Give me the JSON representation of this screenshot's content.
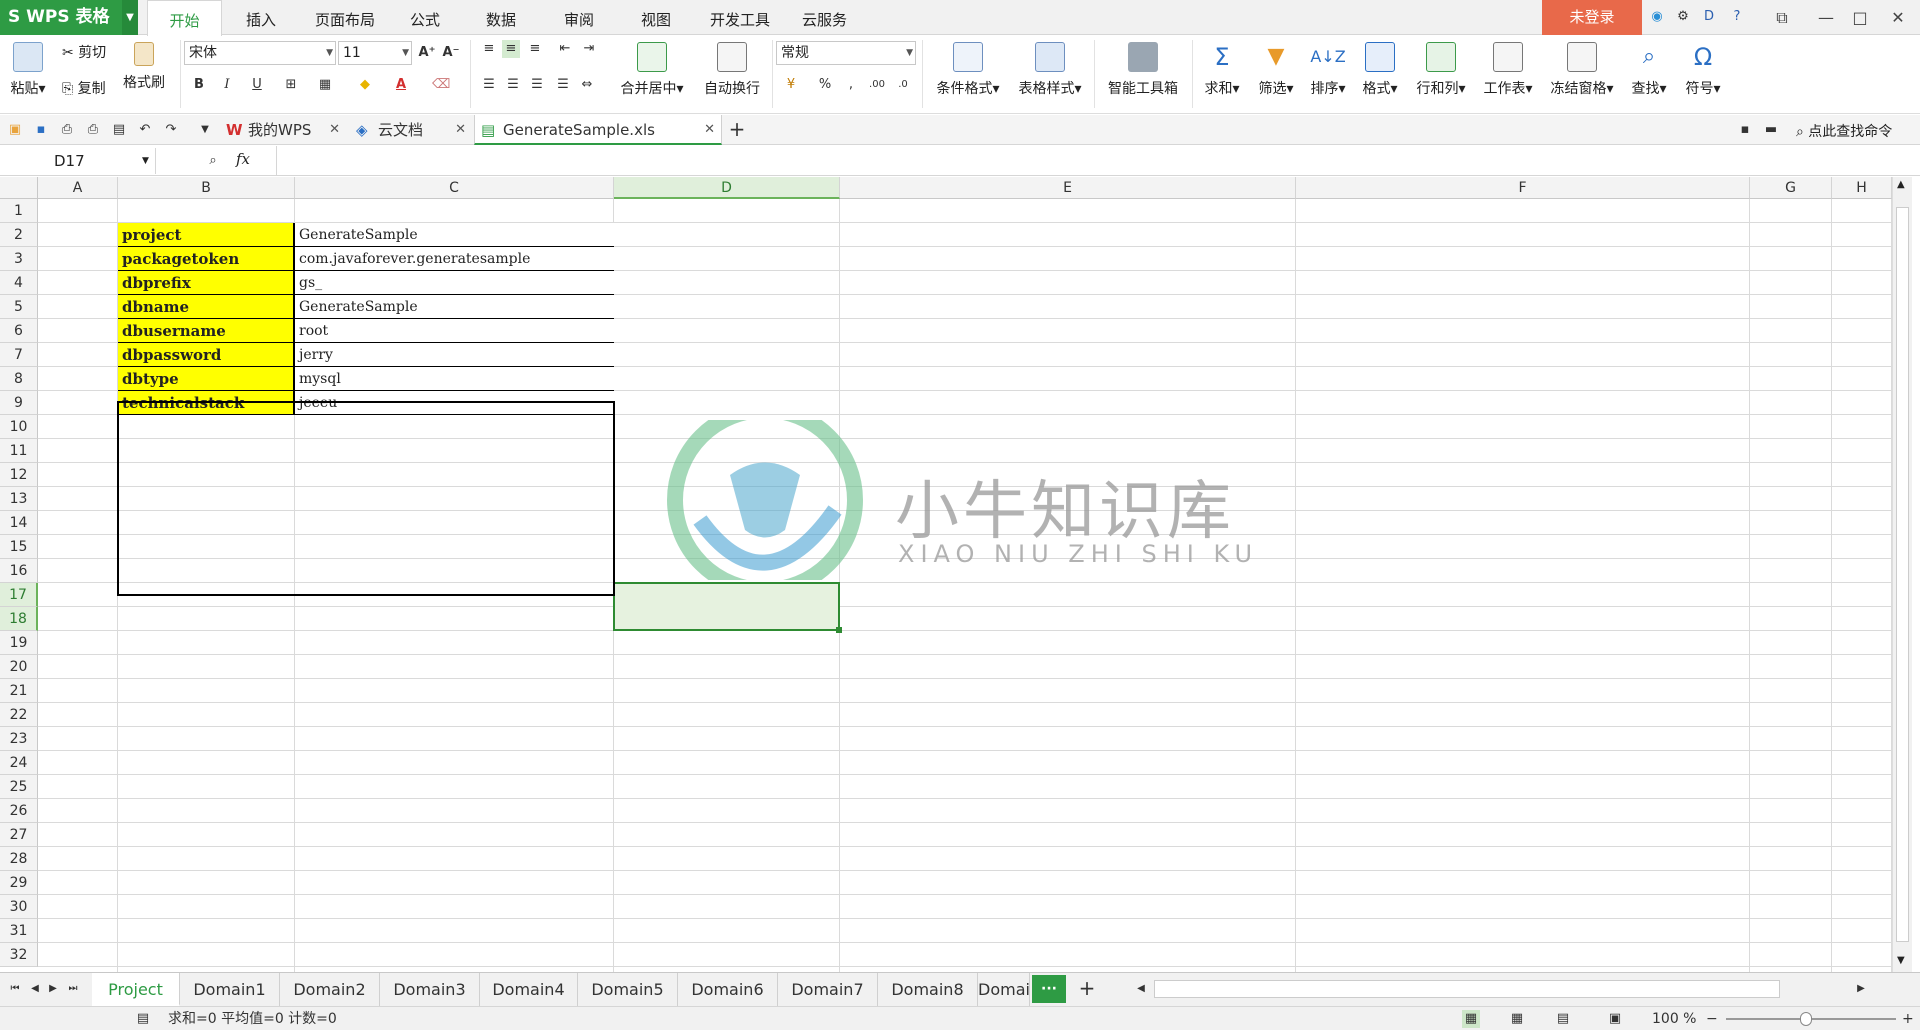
{
  "app": {
    "title": "WPS 表格"
  },
  "menu_tabs": [
    "开始",
    "插入",
    "页面布局",
    "公式",
    "数据",
    "审阅",
    "视图",
    "开发工具",
    "云服务"
  ],
  "login_label": "未登录",
  "ribbon": {
    "paste": "粘贴",
    "cut": "剪切",
    "copy": "复制",
    "format_painter": "格式刷",
    "font_name": "宋体",
    "font_size": "11",
    "bold": "B",
    "italic": "I",
    "underline": "U",
    "font_color_glyph": "A",
    "merge_center": "合并居中",
    "wrap_text": "自动换行",
    "number_format": "常规",
    "percent": "%",
    "cond_format": "条件格式",
    "table_style": "表格样式",
    "smart_toolbox": "智能工具箱",
    "sum": "求和",
    "filter": "筛选",
    "sort": "排序",
    "format": "格式",
    "row_col": "行和列",
    "worksheet": "工作表",
    "freeze": "冻结窗格",
    "find": "查找",
    "symbol": "符号"
  },
  "doc_tabs": {
    "my_wps": "我的WPS",
    "cloud_docs": "云文档",
    "file": "GenerateSample.xls"
  },
  "search_cmd": "点此查找命令",
  "namebox": "D17",
  "fx_label": "fx",
  "columns": [
    "A",
    "B",
    "C",
    "D",
    "E",
    "F",
    "G",
    "H"
  ],
  "rows": [
    "1",
    "2",
    "3",
    "4",
    "5",
    "6",
    "7",
    "8",
    "9",
    "10",
    "11",
    "12",
    "13",
    "14",
    "15",
    "16",
    "17",
    "18",
    "19",
    "20",
    "21",
    "22",
    "23",
    "24",
    "25",
    "26",
    "27",
    "28",
    "29",
    "30",
    "31",
    "32"
  ],
  "table": [
    {
      "key": "project",
      "value": "GenerateSample"
    },
    {
      "key": "packagetoken",
      "value": "com.javaforever.generatesample"
    },
    {
      "key": "dbprefix",
      "value": "gs_"
    },
    {
      "key": "dbname",
      "value": "GenerateSample"
    },
    {
      "key": "dbusername",
      "value": "root"
    },
    {
      "key": "dbpassword",
      "value": "jerry"
    },
    {
      "key": "dbtype",
      "value": "mysql"
    },
    {
      "key": "technicalstack",
      "value": "jeeeu"
    }
  ],
  "watermark": {
    "cn": "小牛知识库",
    "en": "XIAO NIU ZHI SHI KU"
  },
  "sheets": [
    "Project",
    "Domain1",
    "Domain2",
    "Domain3",
    "Domain4",
    "Domain5",
    "Domain6",
    "Domain7",
    "Domain8",
    "Domai"
  ],
  "sheet_more": "···",
  "status": {
    "text": "求和=0  平均值=0  计数=0",
    "zoom": "100 %"
  },
  "colors": {
    "accent": "#2e9b44",
    "login": "#e8694a",
    "key_fill": "#ffff00",
    "selection": "#2e8b32"
  }
}
